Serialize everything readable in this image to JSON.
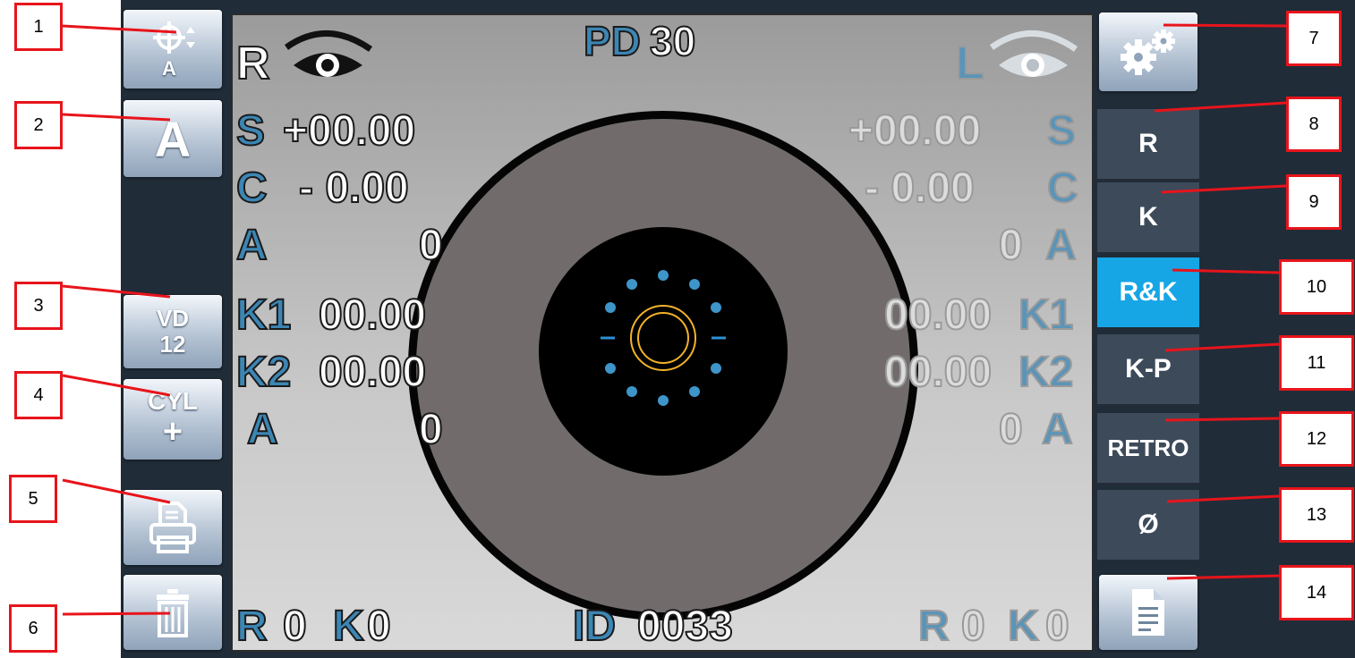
{
  "header": {
    "pd_label": "PD",
    "pd_value": "30",
    "right_eye": "R",
    "left_eye": "L"
  },
  "right": {
    "rows": [
      {
        "label": "S",
        "value": "+00.00"
      },
      {
        "label": "C",
        "value": "- 0.00"
      },
      {
        "label": "A",
        "value": "0"
      },
      {
        "label": "K1",
        "value": "00.00"
      },
      {
        "label": "K2",
        "value": "00.00"
      },
      {
        "label": "A",
        "value": "0"
      }
    ],
    "footer": {
      "r_label": "R",
      "r_value": "0",
      "k_label": "K",
      "k_value": "0"
    }
  },
  "left": {
    "rows": [
      {
        "label": "S",
        "value": "+00.00"
      },
      {
        "label": "C",
        "value": "- 0.00"
      },
      {
        "label": "A",
        "value": "0"
      },
      {
        "label": "K1",
        "value": "00.00"
      },
      {
        "label": "K2",
        "value": "00.00"
      },
      {
        "label": "A",
        "value": "0"
      }
    ],
    "footer": {
      "r_label": "R",
      "r_value": "0",
      "k_label": "K",
      "k_value": "0"
    }
  },
  "id": {
    "label": "ID",
    "value": "0033"
  },
  "left_buttons": {
    "auto_label": "A",
    "auto_align_icon": "crosshair-a-icon",
    "vd_label": "VD",
    "vd_value": "12",
    "cyl_label": "CYL",
    "cyl_sign": "+",
    "print_icon": "printer-icon",
    "delete_icon": "trash-icon"
  },
  "right_buttons": {
    "settings_icon": "gears-icon",
    "modes": [
      "R",
      "K",
      "R&K",
      "K-P",
      "RETRO",
      "Ø"
    ],
    "active_mode": "R&K",
    "report_icon": "document-icon"
  },
  "callouts": [
    "1",
    "2",
    "3",
    "4",
    "5",
    "6",
    "7",
    "8",
    "9",
    "10",
    "11",
    "12",
    "13",
    "14"
  ],
  "colors": {
    "active": "#16a6e6",
    "callout": "#e8141b",
    "label_blue": "#3c86b4"
  }
}
